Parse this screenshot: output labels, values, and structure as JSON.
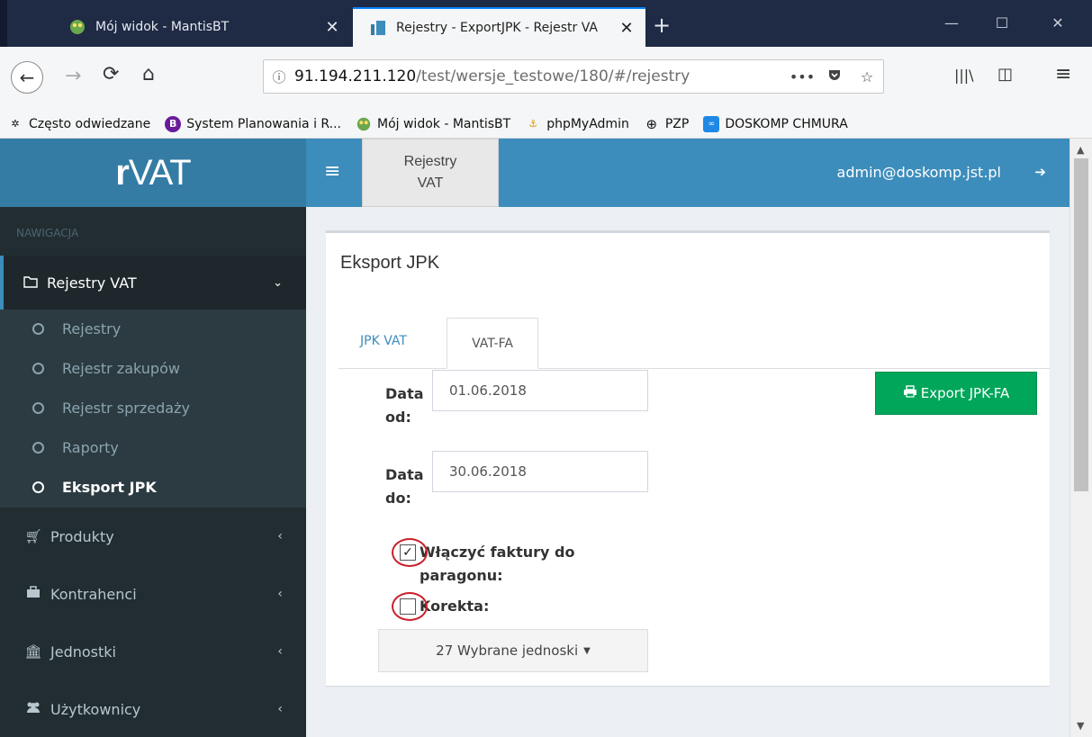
{
  "browser": {
    "tabs": [
      {
        "title": "Mój widok - MantisBT",
        "favicon": "mantis-icon",
        "close": "✕"
      },
      {
        "title": "Rejestry - ExportJPK - Rejestr VA",
        "favicon": "rvat-icon",
        "close": "✕"
      }
    ],
    "new_tab": "+",
    "window": {
      "minimize": "—",
      "maximize": "☐",
      "close": "✕"
    },
    "url": {
      "host": "91.194.211.120",
      "path": "/test/wersje_testowe/180/#/rejestry"
    },
    "bookmarks": [
      {
        "label": "Często odwiedzane",
        "icon": "gear-icon"
      },
      {
        "label": "System Planowania i R...",
        "icon": "b-icon"
      },
      {
        "label": "Mój widok - MantisBT",
        "icon": "mantis-icon"
      },
      {
        "label": "phpMyAdmin",
        "icon": "phpmyadmin-icon"
      },
      {
        "label": "PZP",
        "icon": "globe-icon"
      },
      {
        "label": "DOSKOMP CHMURA",
        "icon": "cloud-icon"
      }
    ]
  },
  "app": {
    "logo": {
      "prefix": "r",
      "main": "VAT"
    },
    "header_tab": [
      "Rejestry",
      "VAT"
    ],
    "user_email": "admin@doskomp.jst.pl",
    "colors": {
      "header": "#3c8dbc",
      "sidebar": "#222d32",
      "success": "#00a65a"
    }
  },
  "sidebar": {
    "nav_header": "NAWIGACJA",
    "open_menu": "Rejestry VAT",
    "subitems": [
      "Rejestry",
      "Rejestr zakupów",
      "Rejestr sprzedaży",
      "Raporty",
      "Eksport JPK"
    ],
    "menus": [
      {
        "label": "Produkty",
        "icon": "cart-icon"
      },
      {
        "label": "Kontrahenci",
        "icon": "briefcase-icon"
      },
      {
        "label": "Jednostki",
        "icon": "bank-icon"
      },
      {
        "label": "Użytkownicy",
        "icon": "users-icon"
      }
    ]
  },
  "main": {
    "title": "Eksport JPK",
    "tabs": [
      "JPK VAT",
      "VAT-FA"
    ],
    "active_tab": "VAT-FA",
    "date_from": {
      "label_1": "Data",
      "label_2": "od:",
      "value": "01.06.2018"
    },
    "date_to": {
      "label_1": "Data",
      "label_2": "do:",
      "value": "30.06.2018"
    },
    "export_button": "Export JPK-FA",
    "include_receipts": {
      "label_1": "Włączyć faktury do",
      "label_2": "paragonu:",
      "checked": true
    },
    "correction": {
      "label": "Korekta:",
      "checked": false
    },
    "units_dropdown": "27 Wybrane jednoski"
  }
}
